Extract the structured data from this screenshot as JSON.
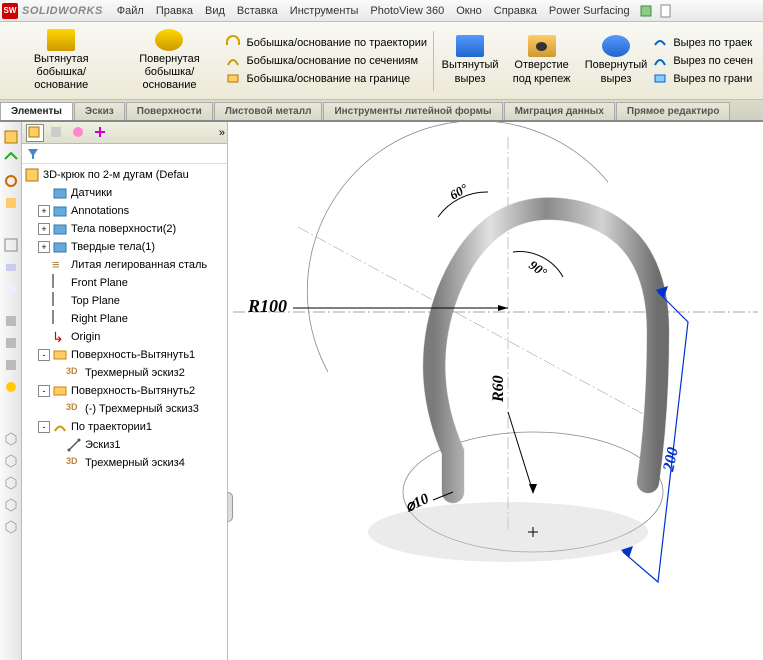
{
  "app": {
    "logo_text": "SOLIDWORKS",
    "logo_mark": "SW"
  },
  "menubar": [
    "Файл",
    "Правка",
    "Вид",
    "Вставка",
    "Инструменты",
    "PhotoView 360",
    "Окно",
    "Справка",
    "Power Surfacing"
  ],
  "ribbon": {
    "extrude": "Вытянутая бобышка/основание",
    "revolve": "Повернутая бобышка/основание",
    "sweep": "Бобышка/основание по траектории",
    "loft": "Бобышка/основание по сечениям",
    "boundary": "Бобышка/основание на границе",
    "cut_extrude": "Вытянутый вырез",
    "hole": "Отверстие под крепеж",
    "cut_revolve": "Повернутый вырез",
    "cut_sweep": "Вырез по траек",
    "cut_loft": "Вырез по сечен",
    "cut_boundary": "Вырез по грани"
  },
  "tabs": [
    "Элементы",
    "Эскиз",
    "Поверхности",
    "Листовой металл",
    "Инструменты литейной формы",
    "Миграция данных",
    "Прямое редактиро"
  ],
  "active_tab": 0,
  "tree": {
    "root": "3D-крюк по 2-м дугам  (Defau",
    "nodes": [
      {
        "label": "Датчики",
        "icon": "folder",
        "indent": 1
      },
      {
        "label": "Annotations",
        "icon": "folder",
        "indent": 1,
        "expand": "+"
      },
      {
        "label": "Тела поверхности(2)",
        "icon": "folder",
        "indent": 1,
        "expand": "+"
      },
      {
        "label": "Твердые тела(1)",
        "icon": "folder",
        "indent": 1,
        "expand": "+"
      },
      {
        "label": "Литая легированная сталь",
        "icon": "sigma",
        "indent": 1
      },
      {
        "label": "Front Plane",
        "icon": "plane",
        "indent": 1
      },
      {
        "label": "Top Plane",
        "icon": "plane",
        "indent": 1
      },
      {
        "label": "Right Plane",
        "icon": "plane",
        "indent": 1
      },
      {
        "label": "Origin",
        "icon": "origin",
        "indent": 1
      },
      {
        "label": "Поверхность-Вытянуть1",
        "icon": "surf",
        "indent": 1,
        "expand": "-"
      },
      {
        "label": "Трехмерный эскиз2",
        "icon": "sketch3d",
        "indent": 2
      },
      {
        "label": "Поверхность-Вытянуть2",
        "icon": "surf",
        "indent": 1,
        "expand": "-"
      },
      {
        "label": "(-) Трехмерный эскиз3",
        "icon": "sketch3d",
        "indent": 2
      },
      {
        "label": "По траектории1",
        "icon": "sweep",
        "indent": 1,
        "expand": "-"
      },
      {
        "label": "Эскиз1",
        "icon": "sketch",
        "indent": 2
      },
      {
        "label": "Трехмерный эскиз4",
        "icon": "sketch3d",
        "indent": 2
      }
    ]
  },
  "dimensions": {
    "r100": "R100",
    "r60": "R60",
    "d10": "⌀10",
    "angle1": "60°",
    "angle2": "90°",
    "len200": "200"
  }
}
